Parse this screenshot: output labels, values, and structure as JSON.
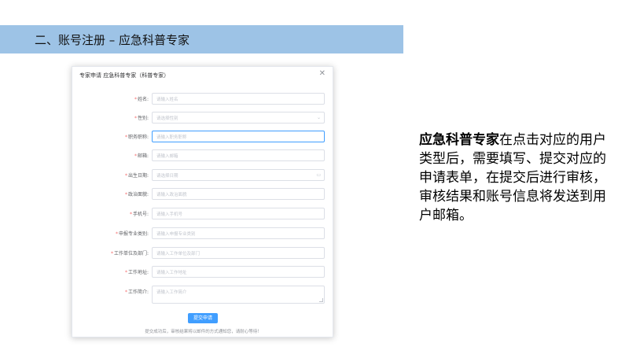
{
  "header": {
    "title": "二、账号注册  –  应急科普专家"
  },
  "dialog": {
    "title": "专家申请 应急科普专家（科普专家）",
    "close_icon": "close-icon",
    "fields": [
      {
        "label": "姓名:",
        "required": true,
        "placeholder": "请输入姓名",
        "type": "input"
      },
      {
        "label": "性别:",
        "required": true,
        "placeholder": "请选择性别",
        "type": "select"
      },
      {
        "label": "职务职称:",
        "required": true,
        "placeholder": "请输入职务职称",
        "type": "input",
        "focused": true
      },
      {
        "label": "邮箱:",
        "required": true,
        "placeholder": "请输入邮箱",
        "type": "input"
      },
      {
        "label": "出生日期:",
        "required": true,
        "placeholder": "请选择日期",
        "type": "date"
      },
      {
        "label": "政治面貌:",
        "required": true,
        "placeholder": "请输入政治面貌",
        "type": "input"
      },
      {
        "label": "手机号:",
        "required": true,
        "placeholder": "请输入手机号",
        "type": "input"
      },
      {
        "label": "申报专业类别:",
        "required": true,
        "placeholder": "请输入申报专业类别",
        "type": "input"
      },
      {
        "label": "工作单位及部门:",
        "required": true,
        "placeholder": "请输入工作单位及部门",
        "type": "input"
      },
      {
        "label": "工作地址:",
        "required": true,
        "placeholder": "请输入工作地址",
        "type": "input"
      },
      {
        "label": "工作简介:",
        "required": true,
        "placeholder": "请输入工作简介",
        "type": "textarea"
      }
    ],
    "submit_label": "提交申请",
    "notice": "提交成功后，审核结果将以邮件的方式通知您，请耐心等待！",
    "accent_color": "#409eff",
    "required_color": "#f56c6c"
  },
  "description": {
    "highlight": "应急科普专家",
    "body": "在点击对应的用户类型后，需要填写、提交对应的申请表单，在提交后进行审核，审核结果和账号信息将发送到用户邮箱。"
  }
}
